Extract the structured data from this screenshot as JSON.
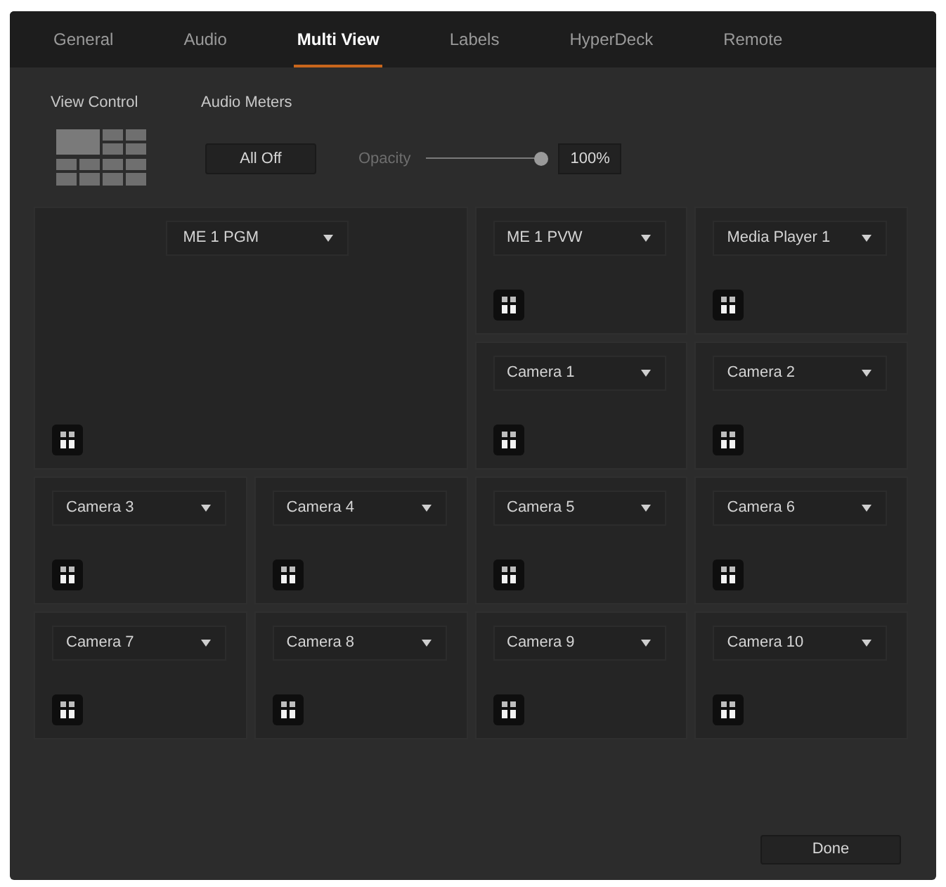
{
  "tabs": [
    {
      "label": "General",
      "selected": false
    },
    {
      "label": "Audio",
      "selected": false
    },
    {
      "label": "Multi View",
      "selected": true
    },
    {
      "label": "Labels",
      "selected": false
    },
    {
      "label": "HyperDeck",
      "selected": false
    },
    {
      "label": "Remote",
      "selected": false
    }
  ],
  "view_control": {
    "label": "View Control"
  },
  "audio_meters": {
    "label": "Audio Meters",
    "button": "All Off",
    "opacity_label": "Opacity",
    "opacity": {
      "level": 1
    },
    "opacity_value": "100%"
  },
  "windows": [
    {
      "kind": "large",
      "source": "ME 1 PGM"
    },
    {
      "kind": "small",
      "source": "ME 1 PVW"
    },
    {
      "kind": "small",
      "source": "Media Player 1"
    },
    {
      "kind": "small",
      "source": "Camera 1"
    },
    {
      "kind": "small",
      "source": "Camera 2"
    },
    {
      "kind": "small",
      "source": "Camera 3"
    },
    {
      "kind": "small",
      "source": "Camera 4"
    },
    {
      "kind": "small",
      "source": "Camera 5"
    },
    {
      "kind": "small",
      "source": "Camera 6"
    },
    {
      "kind": "small",
      "source": "Camera 7"
    },
    {
      "kind": "small",
      "source": "Camera 8"
    },
    {
      "kind": "small",
      "source": "Camera 9"
    },
    {
      "kind": "small",
      "source": "Camera 10"
    }
  ],
  "buttons": [
    "Done"
  ]
}
